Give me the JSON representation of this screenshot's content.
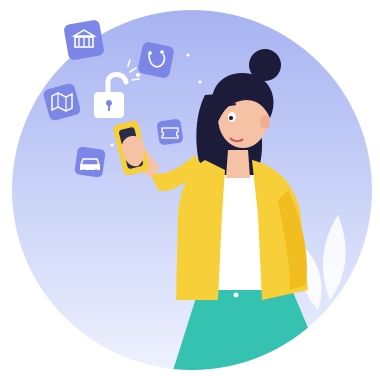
{
  "illustration": {
    "subject": "woman-using-smartphone",
    "floating_icons": [
      "bank-icon",
      "pet-care-icon",
      "map-icon",
      "car-icon",
      "ticket-icon",
      "unlock-icon"
    ],
    "colors": {
      "backdrop_top": "#a7b3f2",
      "backdrop_bottom": "#eceffd",
      "icon_tile": "#7c86e6",
      "icon_glyph": "#ffffff",
      "cardigan": "#f7cf38",
      "skirt": "#35c2b0",
      "hair": "#1c1c3a",
      "skin": "#f6c2a5",
      "phone": "#f7cf38"
    }
  }
}
